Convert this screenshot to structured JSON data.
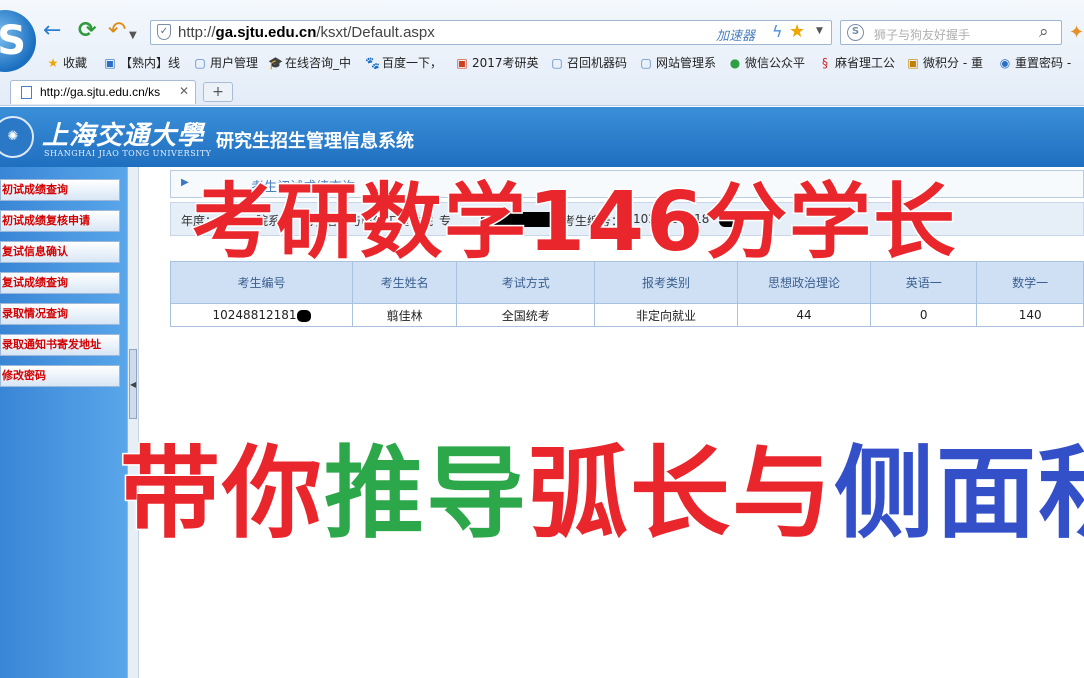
{
  "browser": {
    "address_url_prefix": "http://",
    "address_url_domain": "ga.sjtu.edu.cn",
    "address_url_path": "/ksxt/Default.aspx",
    "accelerator_label": "加速器",
    "search_placeholder": "狮子与狗友好握手",
    "tab_title": "http://ga.sjtu.edu.cn/ks",
    "new_tab": "+",
    "bookmarks": [
      {
        "icon": "★",
        "label": "收藏"
      },
      {
        "icon": "▣",
        "label": "【熟内】线"
      },
      {
        "icon": "▢",
        "label": "用户管理"
      },
      {
        "icon": "🎓",
        "label": "在线咨询_中"
      },
      {
        "icon": "🐾",
        "label": "百度一下，"
      },
      {
        "icon": "▣",
        "label": "2017考研英"
      },
      {
        "icon": "▢",
        "label": "召回机器码"
      },
      {
        "icon": "▢",
        "label": "网站管理系"
      },
      {
        "icon": "●",
        "label": "微信公众平"
      },
      {
        "icon": "§",
        "label": "麻省理工公"
      },
      {
        "icon": "▣",
        "label": "微积分 - 重"
      },
      {
        "icon": "◉",
        "label": "重置密码 -"
      }
    ]
  },
  "site": {
    "university_cn": "上海交通大學",
    "university_en": "SHANGHAI JIAO TONG UNIVERSITY",
    "system_title": "研究生招生管理信息系统"
  },
  "sidebar": {
    "items": [
      {
        "label": "初试成绩查询"
      },
      {
        "label": "初试成绩复核申请"
      },
      {
        "label": "复试信息确认"
      },
      {
        "label": "复试成绩查询"
      },
      {
        "label": "录取情况查询"
      },
      {
        "label": "录取通知书寄发地址"
      },
      {
        "label": "修改密码"
      }
    ]
  },
  "content": {
    "breadcrumb": "考生初试成绩查询",
    "filter": {
      "year_label": "年度：",
      "dept_label": "院系：",
      "dept_value": "电子信息与电气工程学院",
      "major_label": "专",
      "candidate_label": "考生编号：",
      "candidate_value": "1024881218"
    },
    "table": {
      "headers": [
        "考生编号",
        "考生姓名",
        "考试方式",
        "报考类别",
        "思想政治理论",
        "英语一",
        "数学一"
      ],
      "rows": [
        [
          "10248812181",
          "翦佳林",
          "全国统考",
          "非定向就业",
          "44",
          "0",
          "140"
        ]
      ]
    }
  },
  "overlay": {
    "headline": "考研数学146分学长",
    "sub_parts": [
      {
        "text": "带你",
        "color": "red"
      },
      {
        "text": "推导",
        "color": "green"
      },
      {
        "text": "弧长与",
        "color": "red"
      },
      {
        "text": "侧面积",
        "color": "blue"
      }
    ]
  }
}
